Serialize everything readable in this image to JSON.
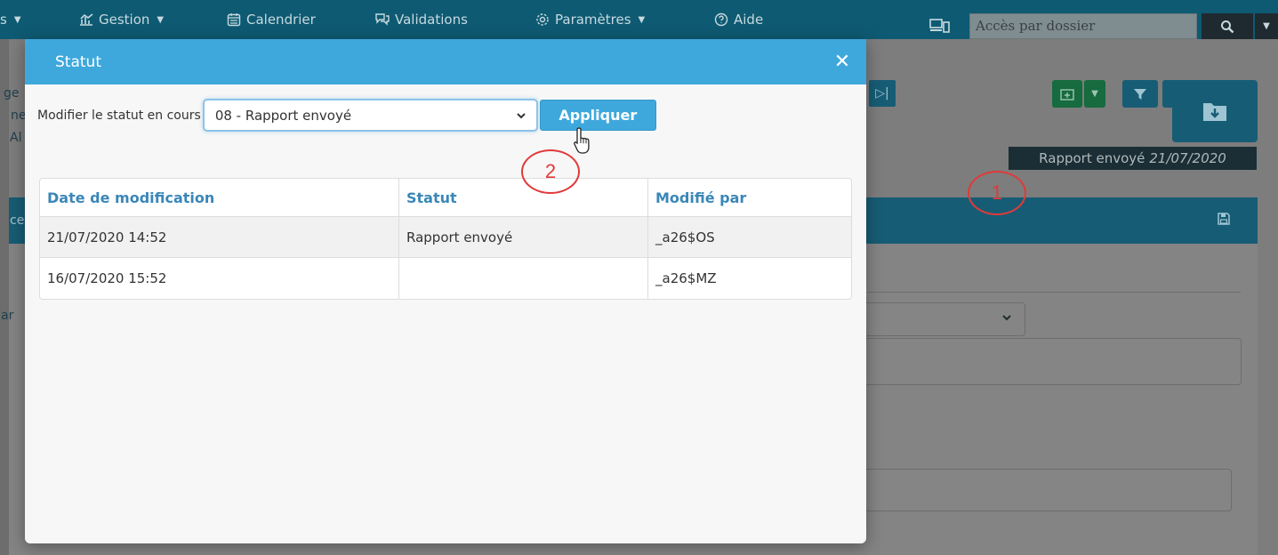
{
  "navbar": {
    "items": [
      {
        "label": "s",
        "has_caret": true
      },
      {
        "label": "Gestion",
        "icon": "chart-icon",
        "has_caret": true
      },
      {
        "label": "Calendrier",
        "icon": "calendar-icon",
        "has_caret": false
      },
      {
        "label": "Validations",
        "icon": "chat-icon",
        "has_caret": false
      },
      {
        "label": "Paramètres",
        "icon": "gear-icon",
        "has_caret": true
      },
      {
        "label": "Aide",
        "icon": "help-icon",
        "has_caret": false
      }
    ],
    "search_placeholder": "Accès par dossier"
  },
  "background": {
    "status_tag_text": "Rapport envoyé",
    "status_tag_date": "21/07/2020",
    "left_fragments": [
      "ge",
      "ne",
      "Al",
      "ce",
      "ar"
    ]
  },
  "annotations": [
    "1",
    "2"
  ],
  "modal": {
    "title": "Statut",
    "status_label": "Modifier le statut en cours",
    "selected_status": "08 - Rapport envoyé",
    "apply_label": "Appliquer",
    "table": {
      "headers": [
        "Date de modification",
        "Statut",
        "Modifié par"
      ],
      "rows": [
        [
          "21/07/2020 14:52",
          "Rapport envoyé",
          "_a26$OS"
        ],
        [
          "16/07/2020 15:52",
          "",
          "_a26$MZ"
        ]
      ]
    }
  },
  "colors": {
    "modal_header": "#3ea8dd",
    "table_header_text": "#3a87b8",
    "annotation": "#e13a3a",
    "navbar": "#0e5a72"
  }
}
